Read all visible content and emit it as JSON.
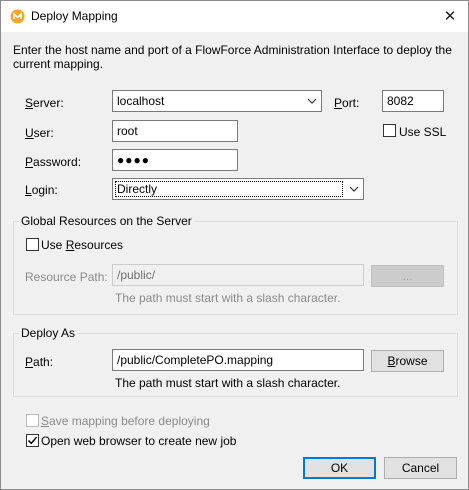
{
  "window": {
    "title": "Deploy Mapping",
    "close_glyph": "✕",
    "app_icon": "altova-mapforce-icon",
    "accent": "#f5a623"
  },
  "intro_text": "Enter the host name and port of a FlowForce Administration Interface to deploy the current mapping.",
  "server": {
    "server_label_key": "S",
    "server_label_rest": "erver:",
    "server_value": "localhost",
    "port_label_key": "P",
    "port_label_rest": "ort:",
    "port_value": "8082",
    "use_ssl_label": "Use SSL",
    "use_ssl_checked": false,
    "user_label_key": "U",
    "user_label_rest": "ser:",
    "user_value": "root",
    "password_label_key": "P",
    "password_label_rest": "assword:",
    "password_value": "●●●●",
    "login_label_key": "L",
    "login_label_rest": "ogin:",
    "login_value": "Directly"
  },
  "global_resources": {
    "group_title": "Global Resources on the Server",
    "use_resources_pre": "Use ",
    "use_resources_key": "R",
    "use_resources_post": "esources",
    "use_resources_checked": false,
    "resource_path_label": "Resource Path:",
    "resource_path_value": "/public/",
    "browse_label": "...",
    "hint": "The path must start with a slash character."
  },
  "deploy_as": {
    "group_title": "Deploy As",
    "path_label_key": "P",
    "path_label_rest": "ath:",
    "path_value": "/public/CompletePO.mapping",
    "browse_key": "B",
    "browse_rest": "rowse",
    "hint": "The path must start with a slash character."
  },
  "options": {
    "save_key": "S",
    "save_rest": "ave mapping before deploying",
    "save_checked": false,
    "open_pre": "Open web browser to create new ",
    "open_key": "j",
    "open_post": "ob",
    "open_checked": true
  },
  "footer": {
    "ok_label": "OK",
    "cancel_label": "Cancel"
  }
}
